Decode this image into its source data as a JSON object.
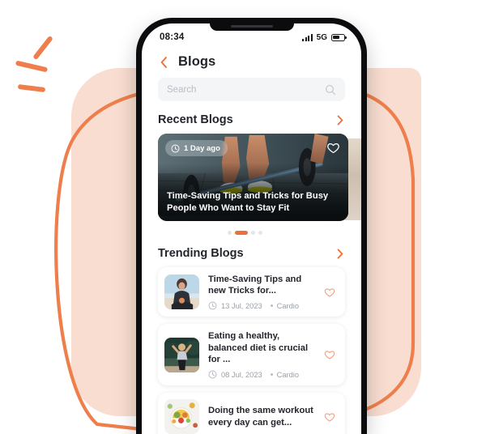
{
  "status_bar": {
    "time": "08:34",
    "network": "5G",
    "signal_icon": "signal-bars-icon",
    "battery_icon": "battery-icon"
  },
  "header": {
    "back_icon": "chevron-left-icon",
    "title": "Blogs"
  },
  "search": {
    "placeholder": "Search",
    "value": "",
    "icon": "search-icon"
  },
  "sections": {
    "recent": {
      "title": "Recent Blogs",
      "arrow_icon": "chevron-right-icon"
    },
    "trending": {
      "title": "Trending Blogs",
      "arrow_icon": "chevron-right-icon"
    }
  },
  "hero": {
    "time_badge": "1 Day ago",
    "clock_icon": "clock-icon",
    "heart_icon": "heart-outline-icon",
    "title": "Time-Saving Tips and Tricks for Busy People Who Want to Stay Fit",
    "dots": [
      {
        "active": false
      },
      {
        "active": true
      },
      {
        "active": false
      },
      {
        "active": false
      }
    ]
  },
  "trending_items": [
    {
      "title": "Time-Saving Tips and new Tricks for...",
      "date": "13 Jul, 2023",
      "tag": "Cardio",
      "clock_icon": "clock-icon",
      "heart_icon": "heart-outline-icon",
      "thumb": "woman-sitting-sky-photo"
    },
    {
      "title": "Eating a healthy, balanced diet is crucial for ...",
      "date": "08 Jul, 2023",
      "tag": "Cardio",
      "clock_icon": "clock-icon",
      "heart_icon": "heart-outline-icon",
      "thumb": "woman-exercising-outdoor-photo"
    },
    {
      "title": "Doing the same workout every day can get...",
      "date": "",
      "tag": "",
      "clock_icon": "clock-icon",
      "heart_icon": "heart-outline-icon",
      "thumb": "healthy-food-bowl-photo"
    }
  ],
  "colors": {
    "accent": "#EE7039",
    "peach": "#F8DDD0",
    "text": "#22252b",
    "muted": "#9aa0a8",
    "field": "#F4F5F7"
  }
}
